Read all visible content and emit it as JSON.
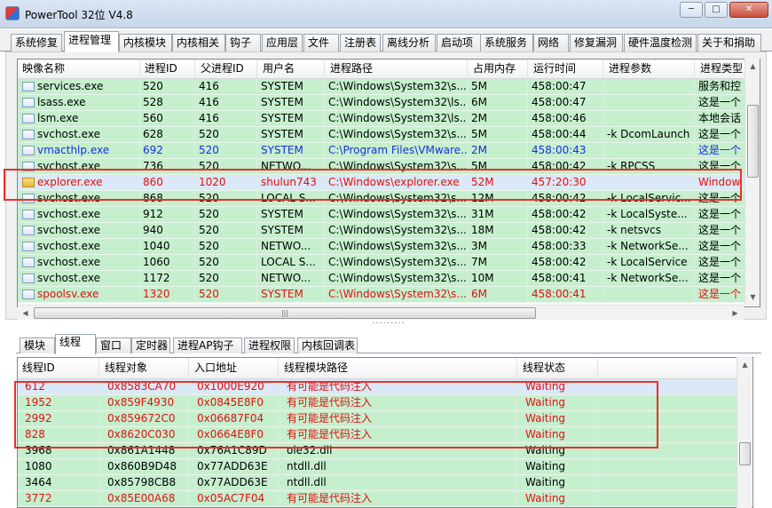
{
  "window": {
    "title": "PowerTool 32位 V4.8",
    "min_glyph": "─",
    "max_glyph": "□",
    "close_glyph": "✕"
  },
  "main_tabs": [
    {
      "label": "系统修复",
      "active": false
    },
    {
      "label": "进程管理",
      "active": true
    },
    {
      "label": "内核模块",
      "active": false
    },
    {
      "label": "内核相关",
      "active": false
    },
    {
      "label": "钩子",
      "active": false
    },
    {
      "label": "应用层",
      "active": false
    },
    {
      "label": "文件",
      "active": false
    },
    {
      "label": "注册表",
      "active": false
    },
    {
      "label": "离线分析",
      "active": false
    },
    {
      "label": "启动项",
      "active": false
    },
    {
      "label": "系统服务",
      "active": false
    },
    {
      "label": "网络",
      "active": false
    },
    {
      "label": "修复漏洞",
      "active": false
    },
    {
      "label": "硬件温度检测",
      "active": false
    },
    {
      "label": "关于和捐助",
      "active": false
    }
  ],
  "process_list": {
    "columns": [
      "映像名称",
      "进程ID",
      "父进程ID",
      "用户名",
      "进程路径",
      "占用内存",
      "运行时间",
      "进程参数",
      "进程类型"
    ],
    "rows": [
      {
        "cells": [
          "services.exe",
          "520",
          "416",
          "SYSTEM",
          "C:\\Windows\\System32\\s...",
          "5M",
          "458:00:47",
          "",
          "服务和控"
        ],
        "color": "black",
        "selected": false
      },
      {
        "cells": [
          "lsass.exe",
          "528",
          "416",
          "SYSTEM",
          "C:\\Windows\\System32\\ls...",
          "6M",
          "458:00:47",
          "",
          "这是一个"
        ],
        "color": "black",
        "selected": false
      },
      {
        "cells": [
          "lsm.exe",
          "560",
          "416",
          "SYSTEM",
          "C:\\Windows\\System32\\ls...",
          "2M",
          "458:00:46",
          "",
          "本地会话"
        ],
        "color": "black",
        "selected": false
      },
      {
        "cells": [
          "svchost.exe",
          "628",
          "520",
          "SYSTEM",
          "C:\\Windows\\System32\\s...",
          "5M",
          "458:00:44",
          "-k DcomLaunch",
          "这是一个"
        ],
        "color": "black",
        "selected": false
      },
      {
        "cells": [
          "vmacthlp.exe",
          "692",
          "520",
          "SYSTEM",
          "C:\\Program Files\\VMware...",
          "2M",
          "458:00:43",
          "",
          "这是一个"
        ],
        "color": "blue",
        "selected": false
      },
      {
        "cells": [
          "svchost.exe",
          "736",
          "520",
          "NETWO...",
          "C:\\Windows\\System32\\s...",
          "5M",
          "458:00:42",
          "-k RPCSS",
          "这是一个"
        ],
        "color": "black",
        "selected": false
      },
      {
        "cells": [
          "explorer.exe",
          "860",
          "1020",
          "shulun743",
          "C:\\Windows\\explorer.exe",
          "52M",
          "457:20:30",
          "",
          "Window"
        ],
        "color": "red",
        "selected": true
      },
      {
        "cells": [
          "svchost.exe",
          "868",
          "520",
          "LOCAL S...",
          "C:\\Windows\\System32\\s...",
          "12M",
          "458:00:42",
          "-k LocalServic...",
          "这是一个"
        ],
        "color": "black",
        "selected": false
      },
      {
        "cells": [
          "svchost.exe",
          "912",
          "520",
          "SYSTEM",
          "C:\\Windows\\System32\\s...",
          "31M",
          "458:00:42",
          "-k LocalSyste...",
          "这是一个"
        ],
        "color": "black",
        "selected": false
      },
      {
        "cells": [
          "svchost.exe",
          "940",
          "520",
          "SYSTEM",
          "C:\\Windows\\System32\\s...",
          "18M",
          "458:00:42",
          "-k netsvcs",
          "这是一个"
        ],
        "color": "black",
        "selected": false
      },
      {
        "cells": [
          "svchost.exe",
          "1040",
          "520",
          "NETWO...",
          "C:\\Windows\\System32\\s...",
          "3M",
          "458:00:33",
          "-k NetworkSe...",
          "这是一个"
        ],
        "color": "black",
        "selected": false
      },
      {
        "cells": [
          "svchost.exe",
          "1060",
          "520",
          "LOCAL S...",
          "C:\\Windows\\System32\\s...",
          "7M",
          "458:00:42",
          "-k LocalService",
          "这是一个"
        ],
        "color": "black",
        "selected": false
      },
      {
        "cells": [
          "svchost.exe",
          "1172",
          "520",
          "NETWO...",
          "C:\\Windows\\System32\\s...",
          "10M",
          "458:00:41",
          "-k NetworkSe...",
          "这是一个"
        ],
        "color": "black",
        "selected": false
      },
      {
        "cells": [
          "spoolsv.exe",
          "1320",
          "520",
          "SYSTEM",
          "C:\\Windows\\System32\\s...",
          "6M",
          "458:00:41",
          "",
          "这是一个"
        ],
        "color": "red",
        "selected": false
      }
    ],
    "hscroll_grip": "|||"
  },
  "splitter_grip": "·········",
  "sub_tabs": [
    {
      "label": "模块",
      "active": false
    },
    {
      "label": "线程",
      "active": true
    },
    {
      "label": "窗口",
      "active": false
    },
    {
      "label": "定时器",
      "active": false
    },
    {
      "label": "进程AP钩子",
      "active": false
    },
    {
      "label": "进程权限",
      "active": false
    },
    {
      "label": "内核回调表",
      "active": false
    }
  ],
  "thread_list": {
    "columns": [
      "线程ID",
      "线程对象",
      "入口地址",
      "线程模块路径",
      "线程状态"
    ],
    "rows": [
      {
        "cells": [
          "612",
          "0x8583CA70",
          "0x1000E920",
          "有可能是代码注入",
          "Waiting"
        ],
        "color": "red",
        "selected": true
      },
      {
        "cells": [
          "1952",
          "0x859F4930",
          "0x0845E8F0",
          "有可能是代码注入",
          "Waiting"
        ],
        "color": "red",
        "selected": false
      },
      {
        "cells": [
          "2992",
          "0x859672C0",
          "0x06687F04",
          "有可能是代码注入",
          "Waiting"
        ],
        "color": "red",
        "selected": false
      },
      {
        "cells": [
          "828",
          "0x8620C030",
          "0x0664E8F0",
          "有可能是代码注入",
          "Waiting"
        ],
        "color": "red",
        "selected": false
      },
      {
        "cells": [
          "3968",
          "0x861A1448",
          "0x76A1C89D",
          "ole32.dll",
          "Waiting"
        ],
        "color": "black",
        "selected": false
      },
      {
        "cells": [
          "1080",
          "0x860B9D48",
          "0x77ADD63E",
          "ntdll.dll",
          "Waiting"
        ],
        "color": "black",
        "selected": false
      },
      {
        "cells": [
          "3464",
          "0x85798CB8",
          "0x77ADD63E",
          "ntdll.dll",
          "Waiting"
        ],
        "color": "black",
        "selected": false
      },
      {
        "cells": [
          "3772",
          "0x85E00A68",
          "0x05AC7F04",
          "有可能是代码注入",
          "Waiting"
        ],
        "color": "red",
        "selected": false
      }
    ]
  },
  "colors": {
    "row_green": "#c6efce",
    "selected_row": "#dbe8f7",
    "text_red": "#e01010",
    "text_blue": "#1a2ee0",
    "annotation_red": "#e8302a"
  }
}
